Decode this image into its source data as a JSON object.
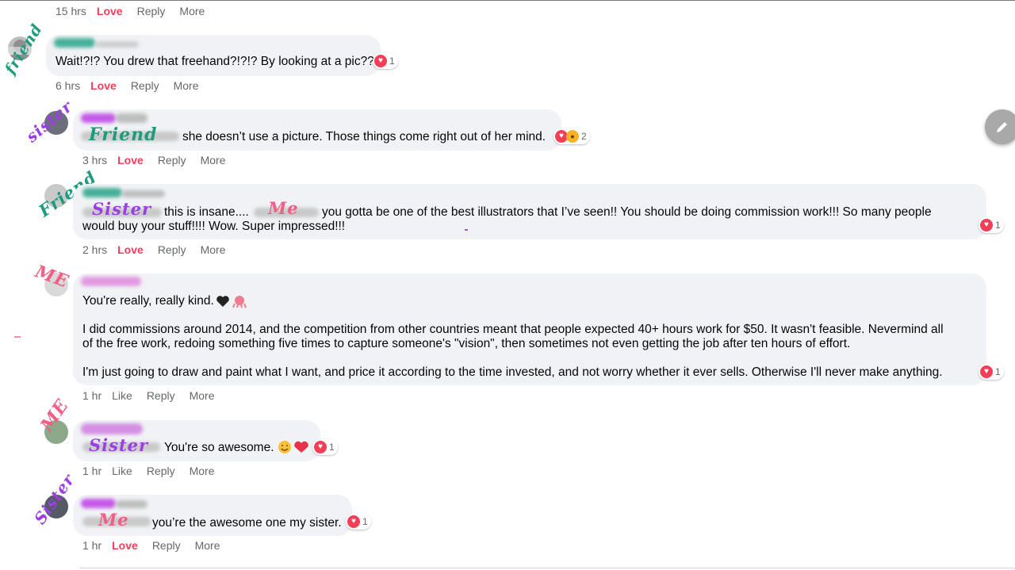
{
  "comments": [
    {
      "id": "c0",
      "meta": {
        "time": "15 hrs",
        "love": "Love",
        "reply": "Reply",
        "more": "More"
      }
    },
    {
      "id": "c1",
      "annotation": "friend",
      "text": "Wait!?!? You drew that freehand?!?!? By looking at a pic??",
      "reaction_count": "1",
      "meta": {
        "time": "6 hrs",
        "love": "Love",
        "reply": "Reply",
        "more": "More"
      }
    },
    {
      "id": "c2",
      "annotation": "sister",
      "tag_annotation": "Friend",
      "text": "she doesn’t use a picture. Those things come right out of her mind.",
      "reaction_count": "2",
      "meta": {
        "time": "3 hrs",
        "love": "Love",
        "reply": "Reply",
        "more": "More"
      }
    },
    {
      "id": "c3",
      "annotation": "Friend",
      "tag1_annotation": "Sister",
      "tag2_annotation": "Me",
      "text_a": "this is insane....",
      "text_b": "you gotta be one of the best illustrators that I’ve seen!! You should be doing commission work!!! So many people",
      "text_c": "would buy your stuff!!!! Wow. Super impressed!!!",
      "reaction_count": "1",
      "meta": {
        "time": "2 hrs",
        "love": "Love",
        "reply": "Reply",
        "more": "More"
      }
    },
    {
      "id": "c4",
      "annotation": "ME",
      "line1": "You're really, really kind.",
      "line2": "I did commissions around 2014, and the competition from other countries meant that people expected 40+ hours work for $50. It wasn't feasible. Nevermind all",
      "line3": "of the free work, redoing something five times to capture someone's \"vision\", then sometimes not even getting the job after ten hours of effort.",
      "line4": "I'm just going to draw and paint what I want, and price it according to the time invested, and not worry whether it ever sells. Otherwise I'll never make anything.",
      "reaction_count": "1",
      "meta": {
        "time": "1 hr",
        "like": "Like",
        "reply": "Reply",
        "more": "More"
      }
    },
    {
      "id": "c5",
      "annotation": "ME",
      "tag_annotation": "Sister",
      "text": "You're so awesome.",
      "reaction_count": "1",
      "meta": {
        "time": "1 hr",
        "like": "Like",
        "reply": "Reply",
        "more": "More"
      }
    },
    {
      "id": "c6",
      "annotation": "Sister",
      "tag_annotation": "Me",
      "text": "you’re the awesome one my sister.",
      "reaction_count": "1",
      "meta": {
        "time": "1 hr",
        "love": "Love",
        "reply": "Reply",
        "more": "More"
      }
    }
  ],
  "icons": {
    "heart": "heart-reaction-icon",
    "wow": "wow-reaction-icon",
    "edit": "pencil-edit-icon"
  },
  "colors": {
    "love": "#f33e58",
    "bubble": "#f0f2f5",
    "meta": "#65676b"
  }
}
